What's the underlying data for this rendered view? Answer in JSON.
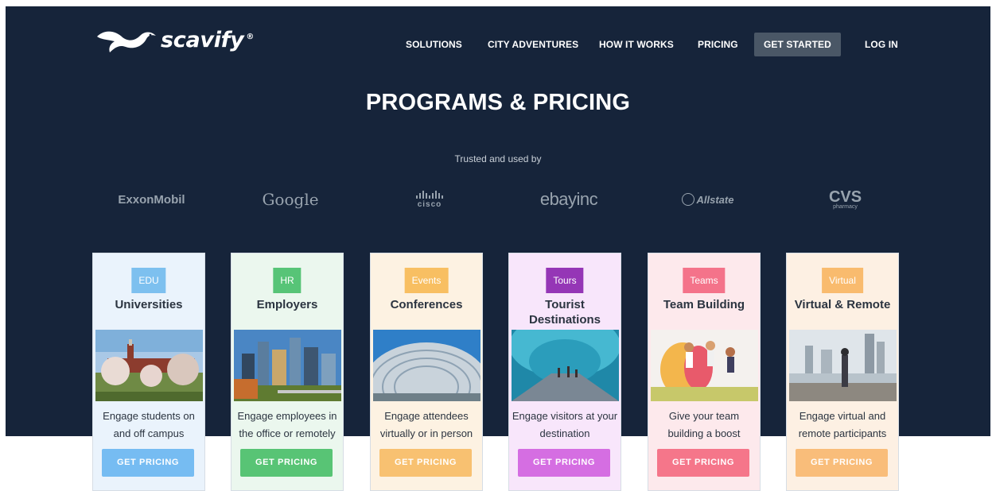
{
  "brand": {
    "name": "scavify",
    "reg": "®"
  },
  "nav": {
    "items": [
      "SOLUTIONS",
      "CITY ADVENTURES",
      "HOW IT WORKS",
      "PRICING"
    ],
    "cta": "GET STARTED",
    "login": "LOG IN"
  },
  "hero": {
    "title": "PROGRAMS & PRICING",
    "trusted": "Trusted and used by"
  },
  "logos": {
    "exxon": "ExxonMobil",
    "google": "Google",
    "cisco": "cisco",
    "ebay_main": "ebay",
    "ebay_sub": "inc",
    "allstate": "Allstate",
    "cvs": "CVS",
    "cvs_sub": "pharmacy"
  },
  "cards": [
    {
      "tag": "EDU",
      "title": "Universities",
      "desc1": "Engage students on",
      "desc2": "and off campus",
      "button": "GET PRICING",
      "tag_color": "#7dc0ef",
      "bg_color": "#eaf3fc",
      "button_color": "#76bcf2"
    },
    {
      "tag": "HR",
      "title": "Employers",
      "desc1": "Engage employees in",
      "desc2": "the office or remotely",
      "button": "GET PRICING",
      "tag_color": "#57c477",
      "bg_color": "#ebf7ee",
      "button_color": "#58c475"
    },
    {
      "tag": "Events",
      "title": "Conferences",
      "desc1": "Engage attendees",
      "desc2": "virtually or in person",
      "button": "GET PRICING",
      "tag_color": "#f8bf62",
      "bg_color": "#fdf2e2",
      "button_color": "#f8c171"
    },
    {
      "tag": "Tours",
      "title": "Tourist Destinations",
      "desc1": "Engage visitors at your",
      "desc2": "destination",
      "button": "GET PRICING",
      "tag_color": "#9536b6",
      "bg_color": "#f8e6fb",
      "button_color": "#d56ee2"
    },
    {
      "tag": "Teams",
      "title": "Team Building",
      "desc1": "Give your team",
      "desc2": "building a boost",
      "button": "GET PRICING",
      "tag_color": "#f4738a",
      "bg_color": "#fde9ec",
      "button_color": "#f5768a"
    },
    {
      "tag": "Virtual",
      "title": "Virtual & Remote",
      "desc1": "Engage virtual and",
      "desc2": "remote participants",
      "button": "GET PRICING",
      "tag_color": "#f9bb6e",
      "bg_color": "#fdf0e3",
      "button_color": "#f9bd7a"
    }
  ]
}
